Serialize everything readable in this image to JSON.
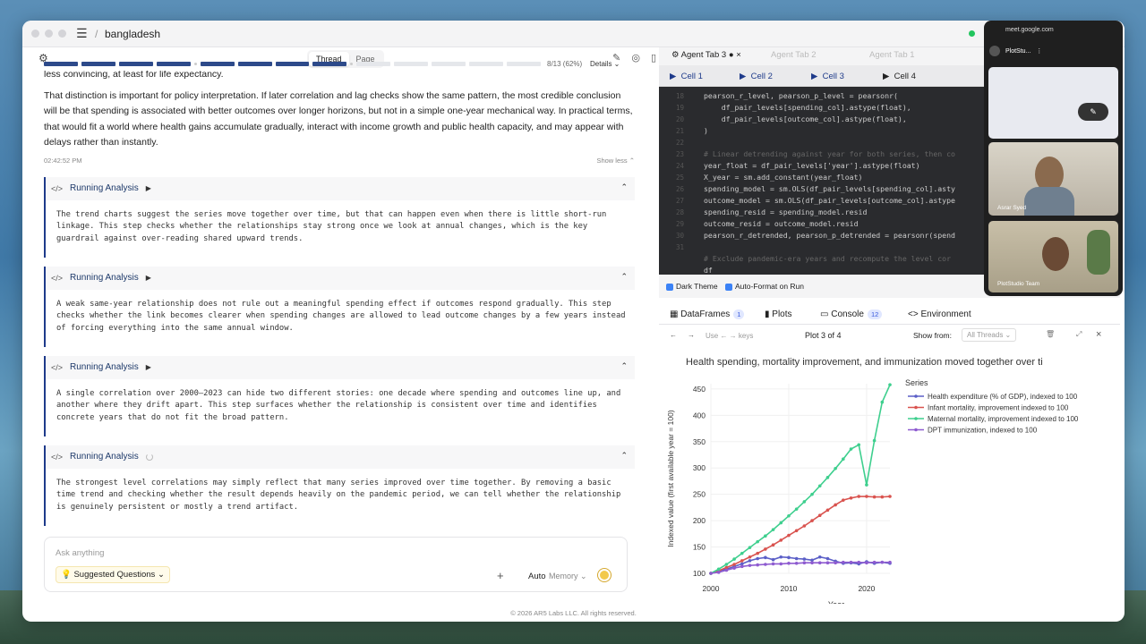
{
  "window": {
    "title": "bangladesh"
  },
  "left": {
    "view_tabs": [
      "Thread",
      "Page"
    ],
    "progress_text": "8/13 (62%)",
    "details_label": "Details",
    "paragraphs": [
      "less convincing, at least for life expectancy.",
      "That distinction is important for policy interpretation. If later correlation and lag checks show the same pattern, the most credible conclusion will be that spending is associated with better outcomes over longer horizons, but not in a simple one-year mechanical way. In practical terms, that would fit a world where health gains accumulate gradually, interact with income growth and public health capacity, and may appear with delays rather than instantly."
    ],
    "timestamp": "02:42:52 PM",
    "show_less": "Show less",
    "cards": [
      {
        "title": "Running Analysis",
        "body": "The trend charts suggest the series move together over time, but that can happen even when there is little short-run linkage. This step checks whether the relationships stay strong once we look at annual changes, which is the key guardrail against over-reading shared upward trends."
      },
      {
        "title": "Running Analysis",
        "body": "A weak same-year relationship does not rule out a meaningful spending effect if outcomes respond gradually. This step checks whether the link becomes clearer when spending changes are allowed to lead outcome changes by a few years instead of forcing everything into the same annual window."
      },
      {
        "title": "Running Analysis",
        "body": "A single correlation over 2000–2023 can hide two different stories: one decade where spending and outcomes line up, and another where they drift apart. This step surfaces whether the relationship is consistent over time and identifies concrete years that do not fit the broad pattern."
      },
      {
        "title": "Running Analysis",
        "body": "The strongest level correlations may simply reflect that many series improved over time together. By removing a basic time trend and checking whether the result depends heavily on the pandemic period, we can tell whether the relationship is genuinely persistent or mostly a trend artifact."
      }
    ],
    "ask_placeholder": "Ask anything",
    "suggested": "Suggested Questions",
    "auto": "Auto",
    "memory": "Memory",
    "footer": "© 2026 AR5 Labs LLC. All rights reserved."
  },
  "right": {
    "agent_tabs": [
      "Agent Tab 3",
      "Agent Tab 2",
      "Agent Tab 1"
    ],
    "cell_tabs": [
      "Cell 1",
      "Cell 2",
      "Cell 3",
      "Cell 4"
    ],
    "line_numbers": [
      "18",
      "19",
      "20",
      "21",
      "22",
      "23",
      "24",
      "25",
      "26",
      "27",
      "28",
      "29",
      "30",
      "31"
    ],
    "code_lines": [
      "pearson_r_level, pearson_p_level = pearsonr(",
      "    df_pair_levels[spending_col].astype(float),",
      "    df_pair_levels[outcome_col].astype(float),",
      ")",
      "",
      "# Linear detrending against year for both series, then co",
      "year_float = df_pair_levels['year'].astype(float)",
      "X_year = sm.add_constant(year_float)",
      "spending_model = sm.OLS(df_pair_levels[spending_col].asty",
      "outcome_model = sm.OLS(df_pair_levels[outcome_col].astype",
      "spending_resid = spending_model.resid",
      "outcome_resid = outcome_model.resid",
      "pearson_r_detrended, pearson_p_detrended = pearsonr(spend",
      "",
      "# Exclude pandemic-era years and recompute the level cor",
      "df"
    ],
    "dark_theme": "Dark Theme",
    "auto_format": "Auto-Format on Run",
    "panel_tabs": {
      "dataframes": "DataFrames",
      "dataframes_count": "1",
      "plots": "Plots",
      "console": "Console",
      "console_count": "12",
      "environment": "Environment"
    },
    "plot_nav": {
      "keys_hint": "Use ← → keys",
      "plot_of": "Plot 3 of 4",
      "show_from": "Show from:",
      "threads": "All Threads"
    }
  },
  "meet": {
    "url": "meet.google.com",
    "name": "PlotStu...",
    "participant1": "Asrar Syed",
    "participant2": "PlotStudio Team"
  },
  "chart_data": {
    "type": "line",
    "title": "Health spending, mortality improvement, and immunization moved together over ti",
    "xlabel": "Year",
    "ylabel": "Indexed value (first available year = 100)",
    "xlim": [
      2000,
      2023
    ],
    "ylim": [
      100,
      460
    ],
    "xticks": [
      2000,
      2010,
      2020
    ],
    "yticks": [
      100,
      150,
      200,
      250,
      300,
      350,
      400,
      450
    ],
    "legend_title": "Series",
    "legend_position": "top-right",
    "x": [
      2000,
      2001,
      2002,
      2003,
      2004,
      2005,
      2006,
      2007,
      2008,
      2009,
      2010,
      2011,
      2012,
      2013,
      2014,
      2015,
      2016,
      2017,
      2018,
      2019,
      2020,
      2021,
      2022,
      2023
    ],
    "series": [
      {
        "name": "Health expenditure (% of GDP), indexed to 100",
        "color": "#5b5fc7",
        "values": [
          100,
          104,
          108,
          113,
          118,
          124,
          128,
          130,
          126,
          131,
          130,
          128,
          127,
          125,
          131,
          128,
          123,
          119,
          120,
          118,
          122,
          119,
          121,
          119
        ]
      },
      {
        "name": "Infant mortality, improvement indexed to 100",
        "color": "#d9534f",
        "values": [
          100,
          105,
          111,
          117,
          124,
          131,
          138,
          146,
          154,
          163,
          172,
          181,
          190,
          200,
          210,
          220,
          230,
          239,
          243,
          246,
          246,
          245,
          245,
          246
        ]
      },
      {
        "name": "Maternal mortality, improvement indexed to 100",
        "color": "#3ecf8e",
        "values": [
          100,
          108,
          117,
          127,
          138,
          149,
          160,
          171,
          183,
          196,
          209,
          222,
          236,
          250,
          266,
          282,
          299,
          317,
          336,
          344,
          268,
          352,
          425,
          458
        ]
      },
      {
        "name": "DPT immunization, indexed to 100",
        "color": "#8e5bd0",
        "values": [
          100,
          102,
          106,
          110,
          113,
          115,
          116,
          117,
          118,
          118,
          119,
          119,
          120,
          120,
          120,
          120,
          120,
          121,
          121,
          121,
          120,
          121,
          121,
          121
        ]
      }
    ]
  }
}
